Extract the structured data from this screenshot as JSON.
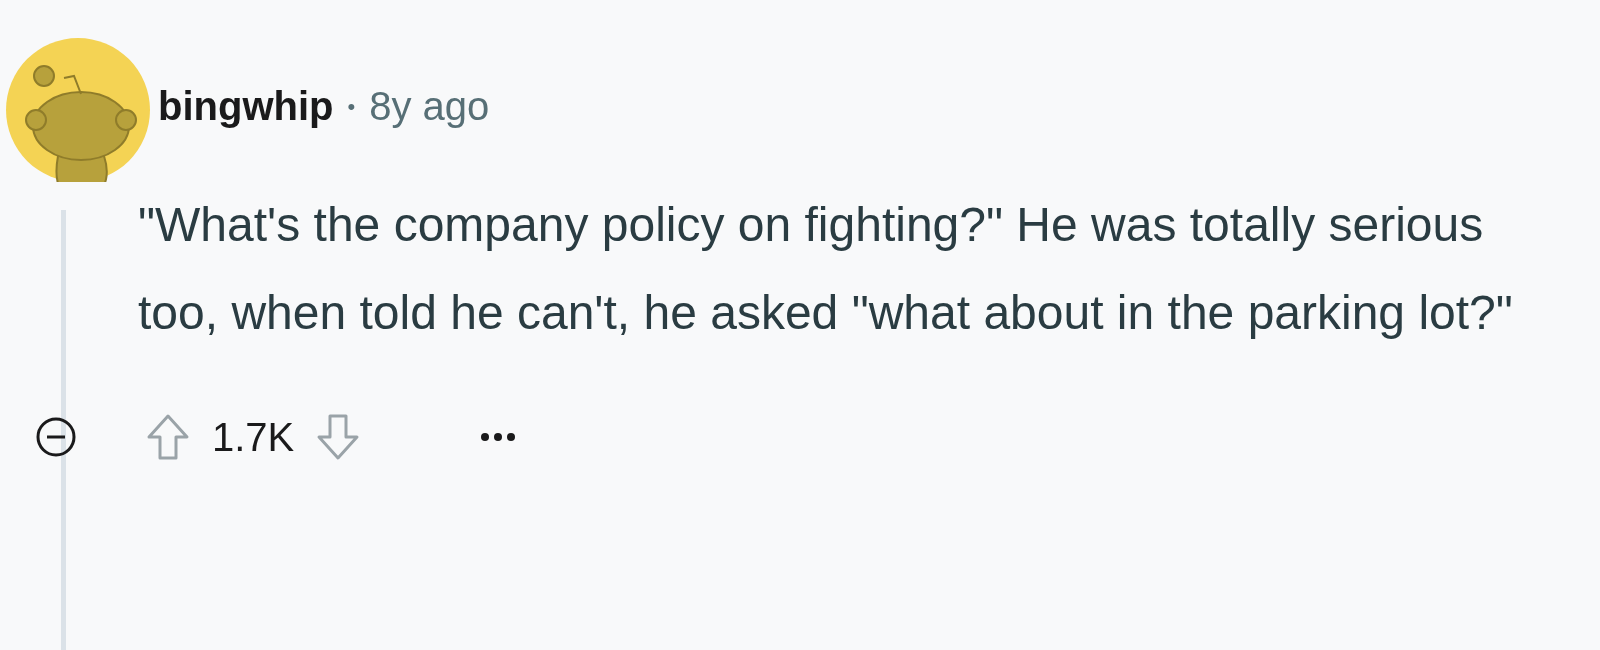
{
  "comment": {
    "author": "bingwhip",
    "separator": "•",
    "time": "8y ago",
    "body": "\"What's the company policy on fighting?\" He was totally serious too, when told he can't, he asked \"what about in the parking lot?\"",
    "score": "1.7K"
  }
}
